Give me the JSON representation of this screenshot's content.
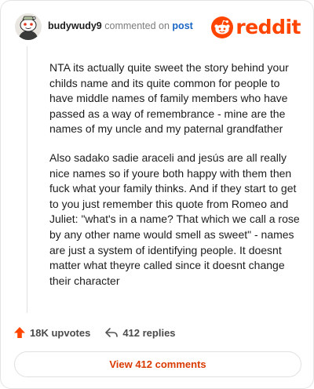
{
  "comment": {
    "username": "budywudy9",
    "action_text": "commented on",
    "post_link": "post",
    "paragraphs": [
      "NTA its actually quite sweet the story behind your childs name and its quite common for people to have middle names of family members who have passed as a way of remembrance - mine are the names of my uncle and my paternal grandfather",
      "Also sadako sadie araceli and jesús are all really nice names so if youre both happy with them then fuck what your family thinks. And if they start to get to you just remember this quote from Romeo and Juliet: \"what's in a name? That which we call a rose by any other name would smell as sweet\" - names are just a system of identifying people. It doesnt matter what theyre called since it doesnt change their character"
    ]
  },
  "brand": {
    "wordmark": "reddit",
    "color": "#ff4500"
  },
  "actions": {
    "upvotes_label": "18K upvotes",
    "replies_label": "412 replies",
    "upvote_color": "#ff4500"
  },
  "footer": {
    "view_comments_label": "View 412 comments",
    "accent": "#d93a00"
  }
}
